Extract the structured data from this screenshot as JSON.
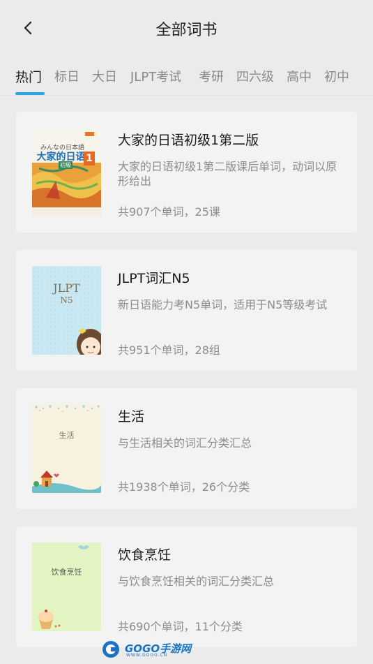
{
  "header": {
    "title": "全部词书",
    "back_icon": "chevron-left-icon"
  },
  "tabs": [
    {
      "label": "热门",
      "active": true
    },
    {
      "label": "标日",
      "active": false
    },
    {
      "label": "大日",
      "active": false
    },
    {
      "label": "JLPT考试",
      "active": false
    },
    {
      "label": "考研",
      "active": false
    },
    {
      "label": "四六级",
      "active": false
    },
    {
      "label": "高中",
      "active": false
    },
    {
      "label": "初中",
      "active": false
    }
  ],
  "accent_color": "#2aa7e0",
  "books": [
    {
      "title": "大家的日语初级1第二版",
      "desc": "大家的日语初级1第二版课后单词，动词以原形给出",
      "stats": "共907个单词，25课",
      "cover": {
        "line1": "みんなの日本語",
        "line2": "大家的日语",
        "badge": "1",
        "sub": "初級"
      }
    },
    {
      "title": "JLPT词汇N5",
      "desc": "新日语能力考N5单词，适用于N5等级考试",
      "stats": "共951个单词，28组",
      "cover": {
        "line1": "JLPT",
        "line2": "N5"
      }
    },
    {
      "title": "生活",
      "desc": "与生活相关的词汇分类汇总",
      "stats": "共1938个单词，26个分类",
      "cover": {
        "line1": "生活"
      }
    },
    {
      "title": "饮食烹饪",
      "desc": "与饮食烹饪相关的词汇分类汇总",
      "stats": "共690个单词，11个分类",
      "cover": {
        "line1": "饮食烹饪"
      }
    }
  ],
  "watermark": {
    "text": "GOGO手游网",
    "sub": "WWW.GOGO.CN"
  }
}
